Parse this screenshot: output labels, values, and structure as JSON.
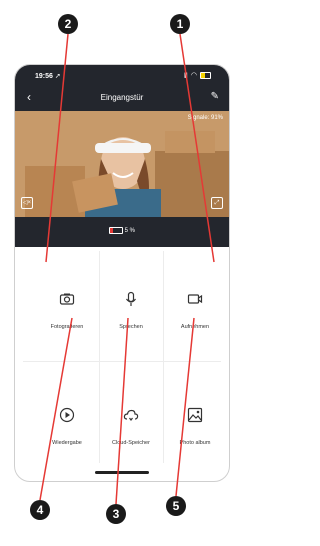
{
  "callouts": {
    "c1": "1",
    "c2": "2",
    "c3": "3",
    "c4": "4",
    "c5": "5"
  },
  "status": {
    "time": "19:56 ➚"
  },
  "header": {
    "title": "Eingangstür"
  },
  "video": {
    "signal": "Signale: 91%"
  },
  "battery": {
    "label": "5 %"
  },
  "actions": [
    {
      "label": "Fotografieren",
      "icon": "camera-icon"
    },
    {
      "label": "Sprechen",
      "icon": "microphone-icon"
    },
    {
      "label": "Aufnehmen",
      "icon": "video-record-icon"
    },
    {
      "label": "Wiedergabe",
      "icon": "playback-icon"
    },
    {
      "label": "Cloud-Speicher",
      "icon": "cloud-icon"
    },
    {
      "label": "Photo album",
      "icon": "photo-album-icon"
    }
  ],
  "colors": {
    "accent": "#e53935",
    "dark": "#23262d"
  }
}
